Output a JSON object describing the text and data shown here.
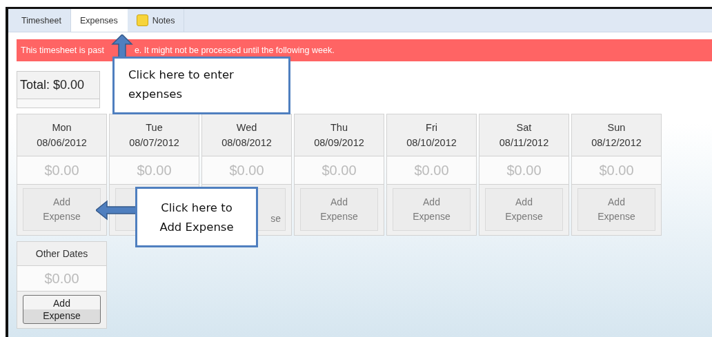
{
  "tabs": [
    {
      "label": "Timesheet",
      "selected": false,
      "kind": "plain"
    },
    {
      "label": "Expenses",
      "selected": true,
      "kind": "plain"
    },
    {
      "label": "Notes",
      "selected": false,
      "kind": "note"
    }
  ],
  "banner": {
    "before_arrow": "This timesheet is past",
    "after_arrow": "e. It might not be processed until the following week."
  },
  "total": {
    "label": "Total: $0.00"
  },
  "days": [
    {
      "day": "Mon",
      "date": "08/06/2012",
      "amount": "$0.00",
      "button": {
        "kind": "full",
        "label": "Add Expense",
        "disabled": true
      }
    },
    {
      "day": "Tue",
      "date": "08/07/2012",
      "amount": "$0.00",
      "button": {
        "kind": "covered",
        "disabled": true
      }
    },
    {
      "day": "Wed",
      "date": "08/08/2012",
      "amount": "$0.00",
      "button": {
        "kind": "partial",
        "label": "se",
        "disabled": true
      }
    },
    {
      "day": "Thu",
      "date": "08/09/2012",
      "amount": "$0.00",
      "button": {
        "kind": "full",
        "label": "Add Expense",
        "disabled": true
      }
    },
    {
      "day": "Fri",
      "date": "08/10/2012",
      "amount": "$0.00",
      "button": {
        "kind": "full",
        "label": "Add Expense",
        "disabled": true
      }
    },
    {
      "day": "Sat",
      "date": "08/11/2012",
      "amount": "$0.00",
      "button": {
        "kind": "full",
        "label": "Add Expense",
        "disabled": true
      }
    },
    {
      "day": "Sun",
      "date": "08/12/2012",
      "amount": "$0.00",
      "button": {
        "kind": "full",
        "label": "Add Expense",
        "disabled": true
      }
    }
  ],
  "other_dates": {
    "label": "Other Dates",
    "amount": "$0.00",
    "button": {
      "kind": "full",
      "label": "Add Expense",
      "disabled": false
    }
  },
  "callouts": [
    {
      "text": "Click here to enter expenses",
      "kind": "up"
    },
    {
      "text": "Click here to Add Expense",
      "kind": "left"
    }
  ]
}
